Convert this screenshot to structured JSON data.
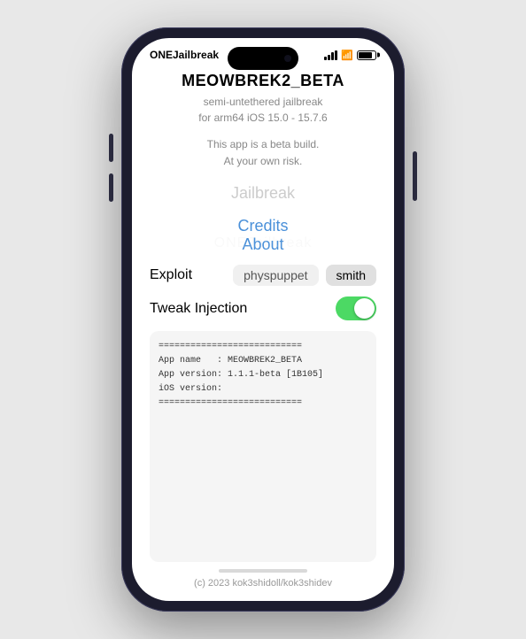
{
  "phone": {
    "status_bar": {
      "carrier": "ONEJailbreak",
      "time": "ONEJailbreak",
      "dynamic_island_indicator": "●"
    }
  },
  "app": {
    "title": "MEOWBREK2_BETA",
    "subtitle_line1": "semi-untethered jailbreak",
    "subtitle_line2": "for arm64 iOS 15.0 - 15.7.6",
    "warning_line1": "This app is a beta build.",
    "warning_line2": "At your own risk.",
    "jailbreak_button": "Jailbreak",
    "credits_button": "Credits",
    "about_button": "About",
    "watermark": "ONEJailbreak",
    "exploit_label": "Exploit",
    "exploit_option1": "physpuppet",
    "exploit_option2": "smith",
    "tweak_label": "Tweak Injection",
    "log": {
      "separator": "===========================",
      "app_name_line": "App name   : MEOWBREK2_BETA",
      "app_version_line": "App version: 1.1.1-beta [1B105]",
      "ios_version_line": "iOS version: ",
      "separator2": "==========================="
    },
    "footer": "(c) 2023 kok3shidoll/kok3shidev"
  }
}
